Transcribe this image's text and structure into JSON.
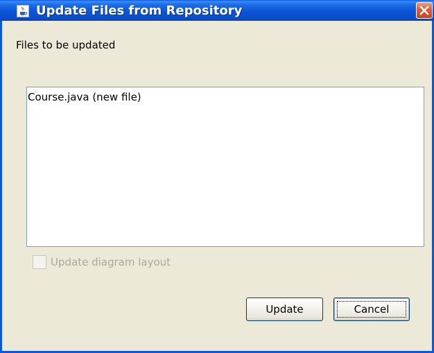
{
  "window": {
    "title": "Update Files from Repository",
    "icon": "java-cup-icon",
    "close_icon": "close-icon"
  },
  "files_section": {
    "label": "Files to be updated",
    "items": [
      {
        "text": "Course.java (new file)"
      }
    ]
  },
  "options": {
    "update_layout": {
      "label": "Update diagram layout",
      "checked": false,
      "enabled": false
    }
  },
  "buttons": {
    "update_label": "Update",
    "cancel_label": "Cancel"
  },
  "colors": {
    "titlebar": "#0b54d6",
    "close_button": "#d9623f",
    "dialog_background": "#ece9d8",
    "disabled_text": "#aca899"
  }
}
